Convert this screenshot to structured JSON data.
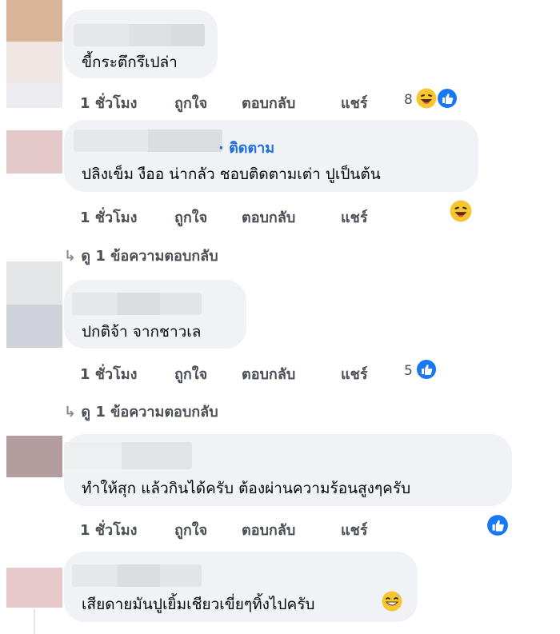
{
  "comments": [
    {
      "text": "ขี้กระตึกรึเปล่า",
      "time": "1 ชั่วโมง",
      "like_label": "ถูกใจ",
      "reply_label": "ตอบกลับ",
      "share_label": "แชร์",
      "reaction_count": "8",
      "reactions": [
        "haha-icon",
        "like-icon"
      ]
    },
    {
      "text": "ปลิงเข็ม งืออ น่ากลัว ชอบติดตามเต่า ปูเป็นต้น",
      "follow_label": "· ติดตาม",
      "time": "1 ชั่วโมง",
      "like_label": "ถูกใจ",
      "reply_label": "ตอบกลับ",
      "share_label": "แชร์",
      "reaction_count": "",
      "reactions": [
        "haha-icon"
      ],
      "view_replies": "ดู 1 ข้อความตอบกลับ"
    },
    {
      "text": "ปกติจ้า จากชาวเล",
      "time": "1 ชั่วโมง",
      "like_label": "ถูกใจ",
      "reply_label": "ตอบกลับ",
      "share_label": "แชร์",
      "reaction_count": "5",
      "reactions": [
        "like-icon"
      ],
      "view_replies": "ดู 1 ข้อความตอบกลับ"
    },
    {
      "text": "ทำให้สุก แล้วกินได้ครับ ต้องผ่านความร้อนสูงๆครับ",
      "time": "1 ชั่วโมง",
      "like_label": "ถูกใจ",
      "reply_label": "ตอบกลับ",
      "share_label": "แชร์",
      "reaction_count": "",
      "reactions": [
        "like-icon"
      ]
    },
    {
      "text": "เสียดายมันปูเยิ้มเชียวเขี่ยๆทิ้งไปครับ",
      "emoji": "sweat-smile-icon"
    }
  ],
  "colors": {
    "bubble": "#f0f2f5",
    "like_blue": "#1877f2",
    "follow_blue": "#216fdb",
    "action_gray": "#4b4f56",
    "emoji_yellow": "#f7c62f"
  }
}
